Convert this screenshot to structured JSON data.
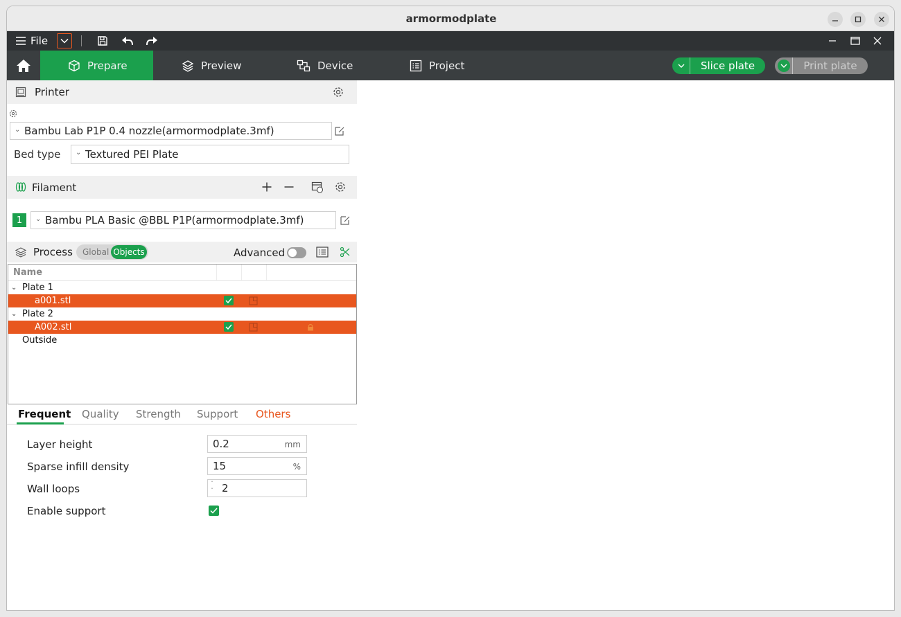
{
  "window": {
    "title": "armormodplate"
  },
  "menubar": {
    "file_label": "File"
  },
  "tabs": [
    {
      "label": "Prepare"
    },
    {
      "label": "Preview"
    },
    {
      "label": "Device"
    },
    {
      "label": "Project"
    }
  ],
  "actions": {
    "slice_label": "Slice plate",
    "print_label": "Print plate"
  },
  "printer": {
    "header": "Printer",
    "selected": "Bambu Lab P1P 0.4 nozzle(armormodplate.3mf)",
    "bed_type_label": "Bed type",
    "bed_type_value": "Textured PEI Plate"
  },
  "filament": {
    "header": "Filament",
    "slot_number": "1",
    "selected": "Bambu PLA Basic @BBL P1P(armormodplate.3mf)",
    "slot_color": "#1ba04d"
  },
  "process": {
    "header": "Process",
    "global_label": "Global",
    "objects_label": "Objects",
    "advanced_label": "Advanced",
    "advanced_on": false
  },
  "object_list": {
    "name_header": "Name",
    "plate1": "Plate 1",
    "item1": "a001.stl",
    "plate2": "Plate 2",
    "item2": "A002.stl",
    "outside": "Outside"
  },
  "settings_tabs": {
    "frequent": "Frequent",
    "quality": "Quality",
    "strength": "Strength",
    "support": "Support",
    "others": "Others"
  },
  "params": {
    "layer_height_label": "Layer height",
    "layer_height_value": "0.2",
    "layer_height_unit": "mm",
    "infill_label": "Sparse infill density",
    "infill_value": "15",
    "infill_unit": "%",
    "wall_loops_label": "Wall loops",
    "wall_loops_value": "2",
    "support_label": "Enable support",
    "support_enabled": true
  },
  "colors": {
    "accent_green": "#1ba04d",
    "selection_orange": "#e8571f",
    "toolbar_dark": "#3a3e40"
  }
}
